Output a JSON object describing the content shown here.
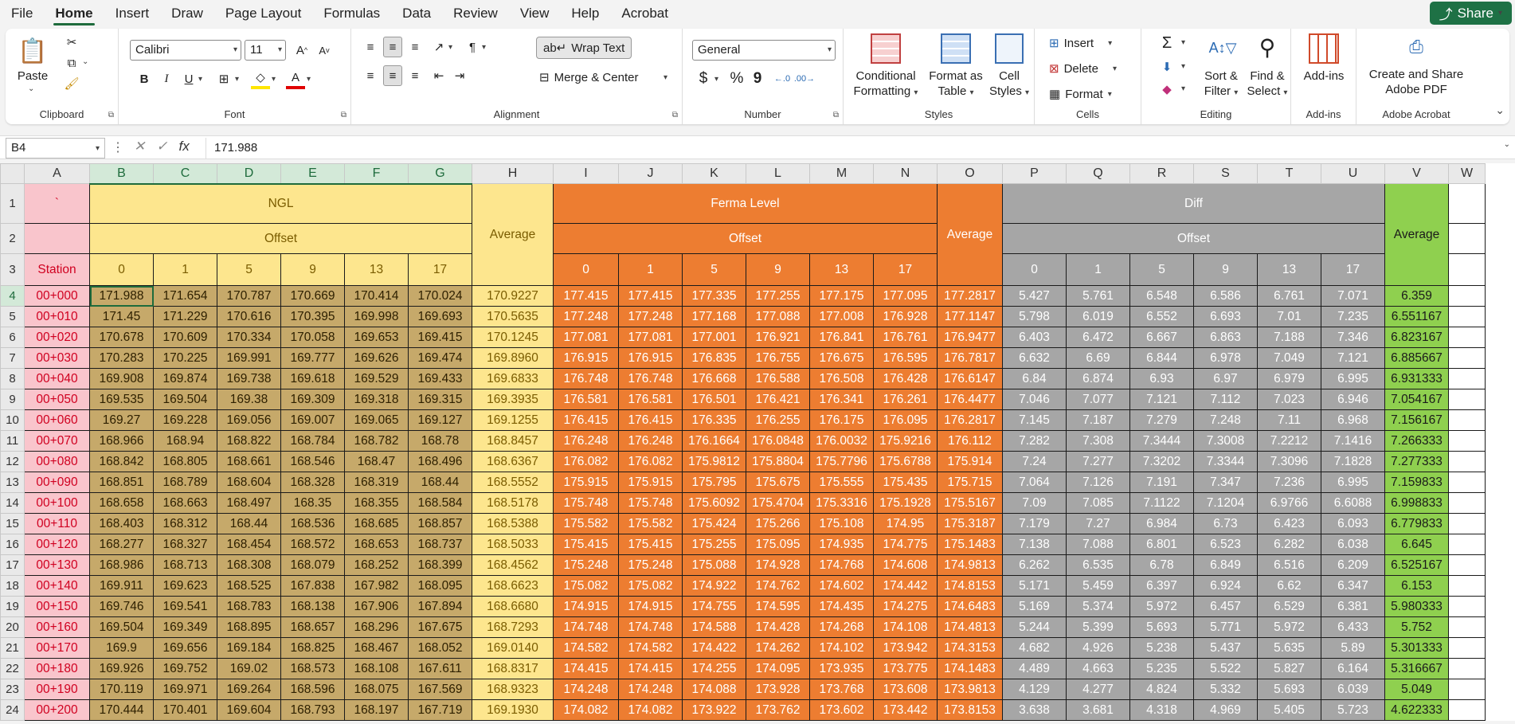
{
  "menu": {
    "items": [
      "File",
      "Home",
      "Insert",
      "Draw",
      "Page Layout",
      "Formulas",
      "Data",
      "Review",
      "View",
      "Help",
      "Acrobat"
    ],
    "active": "Home",
    "share_label": "Share"
  },
  "ribbon": {
    "clipboard": {
      "label": "Clipboard",
      "paste": "Paste"
    },
    "font": {
      "label": "Font",
      "name": "Calibri",
      "size": "11",
      "bold": "B",
      "italic": "I",
      "underline": "U"
    },
    "alignment": {
      "label": "Alignment",
      "wrap": "Wrap Text",
      "merge": "Merge & Center"
    },
    "number": {
      "label": "Number",
      "format": "General",
      "currency": "$",
      "percent": "%",
      "comma": "9"
    },
    "styles": {
      "label": "Styles",
      "conditional": [
        "Conditional",
        "Formatting"
      ],
      "format_table": [
        "Format as",
        "Table"
      ],
      "cell_styles": [
        "Cell",
        "Styles"
      ]
    },
    "cells": {
      "label": "Cells",
      "insert": "Insert",
      "delete": "Delete",
      "format": "Format"
    },
    "editing": {
      "label": "Editing",
      "sort": [
        "Sort &",
        "Filter"
      ],
      "find": [
        "Find &",
        "Select"
      ]
    },
    "addins": {
      "label": "Add-ins",
      "btn": "Add-ins"
    },
    "acrobat": {
      "label": "Adobe Acrobat",
      "btn": [
        "Create and Share",
        "Adobe PDF"
      ]
    }
  },
  "formula_bar": {
    "name_box": "B4",
    "fx": "fx",
    "value": "171.988"
  },
  "sheet": {
    "columns": [
      "A",
      "B",
      "C",
      "D",
      "E",
      "F",
      "G",
      "H",
      "I",
      "J",
      "K",
      "L",
      "M",
      "N",
      "O",
      "P",
      "Q",
      "R",
      "S",
      "T",
      "U",
      "V",
      "W"
    ],
    "a1": "`",
    "station_label": "Station",
    "ngl": "NGL",
    "ferma": "Ferma Level",
    "diff": "Diff",
    "offset": "Offset",
    "average": "Average",
    "offsets": [
      "0",
      "1",
      "5",
      "9",
      "13",
      "17"
    ],
    "rows": [
      [
        "00+000",
        "171.988",
        "171.654",
        "170.787",
        "170.669",
        "170.414",
        "170.024",
        "170.9227",
        "177.415",
        "177.415",
        "177.335",
        "177.255",
        "177.175",
        "177.095",
        "177.2817",
        "5.427",
        "5.761",
        "6.548",
        "6.586",
        "6.761",
        "7.071",
        "6.359"
      ],
      [
        "00+010",
        "171.45",
        "171.229",
        "170.616",
        "170.395",
        "169.998",
        "169.693",
        "170.5635",
        "177.248",
        "177.248",
        "177.168",
        "177.088",
        "177.008",
        "176.928",
        "177.1147",
        "5.798",
        "6.019",
        "6.552",
        "6.693",
        "7.01",
        "7.235",
        "6.551167"
      ],
      [
        "00+020",
        "170.678",
        "170.609",
        "170.334",
        "170.058",
        "169.653",
        "169.415",
        "170.1245",
        "177.081",
        "177.081",
        "177.001",
        "176.921",
        "176.841",
        "176.761",
        "176.9477",
        "6.403",
        "6.472",
        "6.667",
        "6.863",
        "7.188",
        "7.346",
        "6.823167"
      ],
      [
        "00+030",
        "170.283",
        "170.225",
        "169.991",
        "169.777",
        "169.626",
        "169.474",
        "169.8960",
        "176.915",
        "176.915",
        "176.835",
        "176.755",
        "176.675",
        "176.595",
        "176.7817",
        "6.632",
        "6.69",
        "6.844",
        "6.978",
        "7.049",
        "7.121",
        "6.885667"
      ],
      [
        "00+040",
        "169.908",
        "169.874",
        "169.738",
        "169.618",
        "169.529",
        "169.433",
        "169.6833",
        "176.748",
        "176.748",
        "176.668",
        "176.588",
        "176.508",
        "176.428",
        "176.6147",
        "6.84",
        "6.874",
        "6.93",
        "6.97",
        "6.979",
        "6.995",
        "6.931333"
      ],
      [
        "00+050",
        "169.535",
        "169.504",
        "169.38",
        "169.309",
        "169.318",
        "169.315",
        "169.3935",
        "176.581",
        "176.581",
        "176.501",
        "176.421",
        "176.341",
        "176.261",
        "176.4477",
        "7.046",
        "7.077",
        "7.121",
        "7.112",
        "7.023",
        "6.946",
        "7.054167"
      ],
      [
        "00+060",
        "169.27",
        "169.228",
        "169.056",
        "169.007",
        "169.065",
        "169.127",
        "169.1255",
        "176.415",
        "176.415",
        "176.335",
        "176.255",
        "176.175",
        "176.095",
        "176.2817",
        "7.145",
        "7.187",
        "7.279",
        "7.248",
        "7.11",
        "6.968",
        "7.156167"
      ],
      [
        "00+070",
        "168.966",
        "168.94",
        "168.822",
        "168.784",
        "168.782",
        "168.78",
        "168.8457",
        "176.248",
        "176.248",
        "176.1664",
        "176.0848",
        "176.0032",
        "175.9216",
        "176.112",
        "7.282",
        "7.308",
        "7.3444",
        "7.3008",
        "7.2212",
        "7.1416",
        "7.266333"
      ],
      [
        "00+080",
        "168.842",
        "168.805",
        "168.661",
        "168.546",
        "168.47",
        "168.496",
        "168.6367",
        "176.082",
        "176.082",
        "175.9812",
        "175.8804",
        "175.7796",
        "175.6788",
        "175.914",
        "7.24",
        "7.277",
        "7.3202",
        "7.3344",
        "7.3096",
        "7.1828",
        "7.277333"
      ],
      [
        "00+090",
        "168.851",
        "168.789",
        "168.604",
        "168.328",
        "168.319",
        "168.44",
        "168.5552",
        "175.915",
        "175.915",
        "175.795",
        "175.675",
        "175.555",
        "175.435",
        "175.715",
        "7.064",
        "7.126",
        "7.191",
        "7.347",
        "7.236",
        "6.995",
        "7.159833"
      ],
      [
        "00+100",
        "168.658",
        "168.663",
        "168.497",
        "168.35",
        "168.355",
        "168.584",
        "168.5178",
        "175.748",
        "175.748",
        "175.6092",
        "175.4704",
        "175.3316",
        "175.1928",
        "175.5167",
        "7.09",
        "7.085",
        "7.1122",
        "7.1204",
        "6.9766",
        "6.6088",
        "6.998833"
      ],
      [
        "00+110",
        "168.403",
        "168.312",
        "168.44",
        "168.536",
        "168.685",
        "168.857",
        "168.5388",
        "175.582",
        "175.582",
        "175.424",
        "175.266",
        "175.108",
        "174.95",
        "175.3187",
        "7.179",
        "7.27",
        "6.984",
        "6.73",
        "6.423",
        "6.093",
        "6.779833"
      ],
      [
        "00+120",
        "168.277",
        "168.327",
        "168.454",
        "168.572",
        "168.653",
        "168.737",
        "168.5033",
        "175.415",
        "175.415",
        "175.255",
        "175.095",
        "174.935",
        "174.775",
        "175.1483",
        "7.138",
        "7.088",
        "6.801",
        "6.523",
        "6.282",
        "6.038",
        "6.645"
      ],
      [
        "00+130",
        "168.986",
        "168.713",
        "168.308",
        "168.079",
        "168.252",
        "168.399",
        "168.4562",
        "175.248",
        "175.248",
        "175.088",
        "174.928",
        "174.768",
        "174.608",
        "174.9813",
        "6.262",
        "6.535",
        "6.78",
        "6.849",
        "6.516",
        "6.209",
        "6.525167"
      ],
      [
        "00+140",
        "169.911",
        "169.623",
        "168.525",
        "167.838",
        "167.982",
        "168.095",
        "168.6623",
        "175.082",
        "175.082",
        "174.922",
        "174.762",
        "174.602",
        "174.442",
        "174.8153",
        "5.171",
        "5.459",
        "6.397",
        "6.924",
        "6.62",
        "6.347",
        "6.153"
      ],
      [
        "00+150",
        "169.746",
        "169.541",
        "168.783",
        "168.138",
        "167.906",
        "167.894",
        "168.6680",
        "174.915",
        "174.915",
        "174.755",
        "174.595",
        "174.435",
        "174.275",
        "174.6483",
        "5.169",
        "5.374",
        "5.972",
        "6.457",
        "6.529",
        "6.381",
        "5.980333"
      ],
      [
        "00+160",
        "169.504",
        "169.349",
        "168.895",
        "168.657",
        "168.296",
        "167.675",
        "168.7293",
        "174.748",
        "174.748",
        "174.588",
        "174.428",
        "174.268",
        "174.108",
        "174.4813",
        "5.244",
        "5.399",
        "5.693",
        "5.771",
        "5.972",
        "6.433",
        "5.752"
      ],
      [
        "00+170",
        "169.9",
        "169.656",
        "169.184",
        "168.825",
        "168.467",
        "168.052",
        "169.0140",
        "174.582",
        "174.582",
        "174.422",
        "174.262",
        "174.102",
        "173.942",
        "174.3153",
        "4.682",
        "4.926",
        "5.238",
        "5.437",
        "5.635",
        "5.89",
        "5.301333"
      ],
      [
        "00+180",
        "169.926",
        "169.752",
        "169.02",
        "168.573",
        "168.108",
        "167.611",
        "168.8317",
        "174.415",
        "174.415",
        "174.255",
        "174.095",
        "173.935",
        "173.775",
        "174.1483",
        "4.489",
        "4.663",
        "5.235",
        "5.522",
        "5.827",
        "6.164",
        "5.316667"
      ],
      [
        "00+190",
        "170.119",
        "169.971",
        "169.264",
        "168.596",
        "168.075",
        "167.569",
        "168.9323",
        "174.248",
        "174.248",
        "174.088",
        "173.928",
        "173.768",
        "173.608",
        "173.9813",
        "4.129",
        "4.277",
        "4.824",
        "5.332",
        "5.693",
        "6.039",
        "5.049"
      ],
      [
        "00+200",
        "170.444",
        "170.401",
        "169.604",
        "168.793",
        "168.197",
        "167.719",
        "169.1930",
        "174.082",
        "174.082",
        "173.922",
        "173.762",
        "173.602",
        "173.442",
        "173.8153",
        "3.638",
        "3.681",
        "4.318",
        "4.969",
        "5.405",
        "5.723",
        "4.622333"
      ]
    ]
  }
}
